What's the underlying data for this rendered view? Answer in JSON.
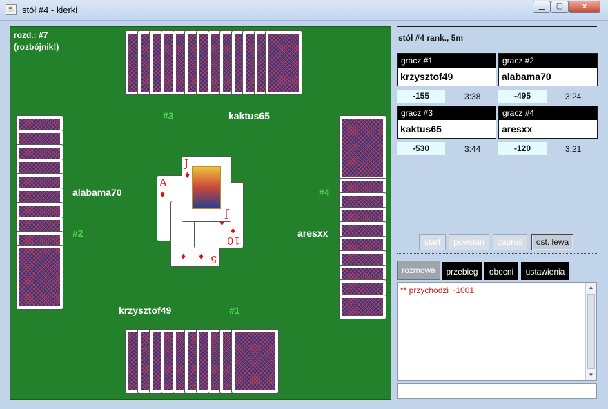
{
  "window": {
    "title": "stół #4 - kierki",
    "icon": "java-cup-icon",
    "controls": [
      "minimize",
      "maximize",
      "close"
    ],
    "close_label": "x"
  },
  "table": {
    "deal_info": "rozd.: #7",
    "deal_mode": "(rozbójnik!)",
    "background": "#22812a",
    "players": {
      "top": "kaktus65",
      "left": "alabama70",
      "right": "aresxx",
      "bottom": "krzysztof49"
    },
    "seats": {
      "top": "#3",
      "left": "#2",
      "right": "#4",
      "bottom": "#1"
    },
    "trick_cards": [
      {
        "rank": "A",
        "suit": "♦"
      },
      {
        "rank": "J",
        "suit": "♦"
      },
      {
        "rank": "10",
        "suit": "♦"
      },
      {
        "rank": "5",
        "suit": "♦"
      }
    ]
  },
  "panel": {
    "header": "stół #4   rank., 5m",
    "players": [
      {
        "label": "gracz #1",
        "name": "krzysztof49",
        "score": "-155",
        "time": "3:38"
      },
      {
        "label": "gracz #2",
        "name": "alabama70",
        "score": "-495",
        "time": "3:24"
      },
      {
        "label": "gracz #3",
        "name": "kaktus65",
        "score": "-530",
        "time": "3:44"
      },
      {
        "label": "gracz #4",
        "name": "aresxx",
        "score": "-120",
        "time": "3:21"
      }
    ],
    "buttons": {
      "start": "start",
      "stand": "powstań",
      "invite": "zaproś",
      "last_trick": "ost. lewa"
    },
    "tabs": [
      "rozmowa",
      "przebieg",
      "obecni",
      "ustawienia"
    ],
    "chat_lines": [
      "** przychodzi ~1001"
    ],
    "chat_input": ""
  }
}
